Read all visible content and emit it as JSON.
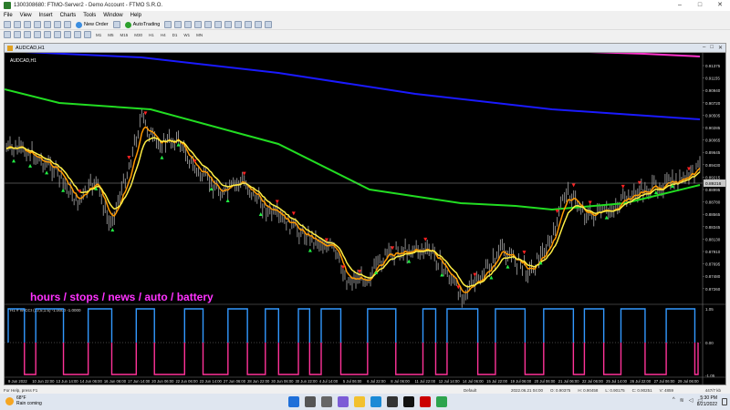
{
  "window": {
    "title": "1300308680: FTMO-Server2 - Demo Account - FTMO S.R.O."
  },
  "menu": [
    "File",
    "View",
    "Insert",
    "Charts",
    "Tools",
    "Window",
    "Help"
  ],
  "toolbar": {
    "new_order": "New Order",
    "autotrading": "AutoTrading"
  },
  "timeframes": [
    "M1",
    "M5",
    "M15",
    "M30",
    "H1",
    "H4",
    "D1",
    "W1",
    "MN"
  ],
  "chart": {
    "caption": "AUDCAD,H1",
    "inner_label": "AUDCAD,H1",
    "overlay_text": "hours / stops / news / auto / battery",
    "indicator_label": "H1 # W CCI (32,5,1.5) -1.0000 -1.0000",
    "bg": "#000000",
    "price_labels": [
      "0.91375",
      "0.91155",
      "0.90940",
      "0.90720",
      "0.90505",
      "0.90285",
      "0.90065",
      "0.89645",
      "0.89430",
      "0.89215",
      "0.88995",
      "0.88780",
      "0.88565",
      "0.88345",
      "0.88130",
      "0.87910",
      "0.87695",
      "0.87480",
      "0.87260"
    ],
    "current_price": "0.89216",
    "indicator_scale": [
      "1.05",
      "0.00",
      "-1.05"
    ],
    "time_labels": [
      "9 Jun 2022",
      "10 Jun 22:00",
      "13 Jun 14:00",
      "14 Jun 06:00",
      "16 Jun 06:00",
      "17 Jun 14:00",
      "20 Jun 06:00",
      "22 Jun 06:00",
      "23 Jun 14:00",
      "27 Jun 06:00",
      "28 Jun 22:00",
      "30 Jun 06:00",
      "30 Jun 22:00",
      "4 Jul 14:00",
      "5 Jul 06:00",
      "6 Jul 22:00",
      "8 Jul 06:00",
      "11 Jul 22:00",
      "12 Jul 14:00",
      "14 Jul 06:00",
      "15 Jul 22:00",
      "19 Jul 06:00",
      "20 Jul 06:00",
      "21 Jul 06:00",
      "22 Jul 06:00",
      "25 Jul 14:00",
      "26 Jul 22:00",
      "27 Jul 06:00",
      "29 Jul 06:00"
    ]
  },
  "statusbar": {
    "help": "For Help, press F1",
    "profile": "Default",
    "datetime": "2022.06.21 04:00",
    "open": "O: 0.90375",
    "high": "H: 0.90458",
    "low": "L: 0.90175",
    "close": "C: 0.90251",
    "volume": "V: 4859",
    "connection": "447/7 kb"
  },
  "taskbar": {
    "temp": "68°F",
    "weather": "Rain coming",
    "time": "5:30 PM",
    "date": "8/21/2022"
  },
  "colors": {
    "blue_ma": "#1a1aff",
    "green_ma": "#22dd22",
    "orange_ma": "#ff9900",
    "yellow_ma": "#ffee44",
    "pink_ma": "#ff33cc",
    "overlay_text": "#ff33ff",
    "cci_pink": "#ff3399",
    "cci_blue": "#3399ff"
  }
}
